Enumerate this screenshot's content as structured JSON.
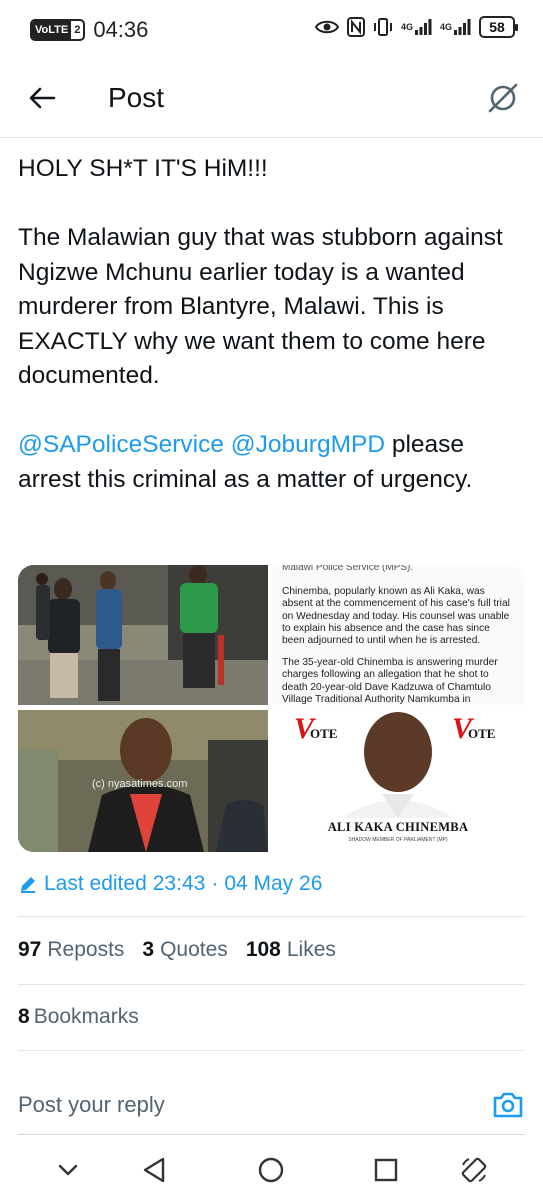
{
  "status_bar": {
    "volte_label": "VoLTE",
    "volte_sim": "2",
    "time": "04:36",
    "signal_label_1": "4G",
    "signal_label_2": "4G",
    "battery": "58"
  },
  "header": {
    "title": "Post"
  },
  "post": {
    "line1": "HOLY SH*T IT'S  HiM!!!",
    "paragraph2": "The Malawian guy that was stubborn against Ngizwe Mchunu earlier today is a wanted murderer from Blantyre, Malawi. This is EXACTLY why we want them to come here documented.",
    "mention1": "@SAPoliceService",
    "mention2": "@JoburgMPD",
    "paragraph3_rest": " please arrest this criminal as a matter of urgency."
  },
  "media": {
    "article_head": "Malawi Police Service (MPS).",
    "article_p1": "Chinemba, popularly known as Ali Kaka, was absent at the commencement of his case's full trial on Wednesday and today. His counsel was unable to explain his absence and the case has since been adjourned to until when he is arrested.",
    "article_p2": "The 35-year-old Chinemba is answering murder charges following an allegation that he shot to death 20-year-old Dave Kadzuwa of Chamtulo Village Traditional Authority Namkumba in",
    "watermark": "(c) nyasatimes.com",
    "vote_left": "OTE",
    "vote_right": "OTE",
    "vote_v": "V",
    "poster_name": "ALI KAKA CHINEMBA",
    "poster_sub": "SHADOW MEMBER OF PARLIAMENT (MP)"
  },
  "edited": {
    "label": "Last edited",
    "time": "23:43",
    "sep": "·",
    "date": "04 May 26"
  },
  "stats": {
    "reposts_count": "97",
    "reposts_label": "Reposts",
    "quotes_count": "3",
    "quotes_label": "Quotes",
    "likes_count": "108",
    "likes_label": "Likes",
    "bookmarks_count": "8",
    "bookmarks_label": "Bookmarks"
  },
  "reply": {
    "placeholder": "Post your reply"
  },
  "colors": {
    "accent": "#1d9bf0",
    "text": "#0f1419",
    "muted": "#536471"
  }
}
